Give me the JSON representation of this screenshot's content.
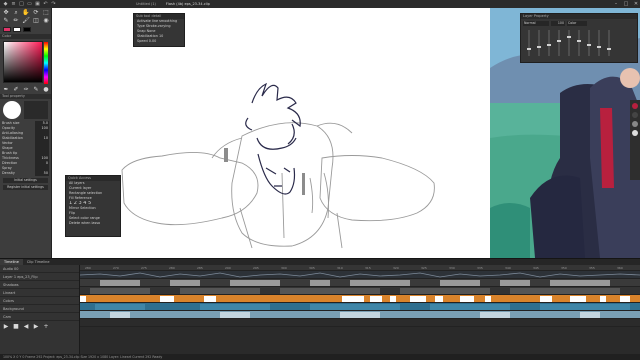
{
  "window": {
    "tabs": [
      "Untitled (1)",
      "Flash (4b) eps_23-34.clip"
    ],
    "controls": [
      "minimize",
      "maximize",
      "close"
    ]
  },
  "tool_property": {
    "title": "Tool property",
    "rows": [
      {
        "label": "Brush size",
        "value": "5.0"
      },
      {
        "label": "Opacity",
        "value": "100"
      },
      {
        "label": "Anti-aliasing",
        "value": ""
      },
      {
        "label": "Stabilization",
        "value": "10"
      },
      {
        "label": "Vector",
        "value": ""
      },
      {
        "label": "Shape",
        "value": ""
      },
      {
        "label": "Brush tip",
        "value": ""
      },
      {
        "label": "Thickness",
        "value": "100"
      },
      {
        "label": "Direction",
        "value": "0"
      },
      {
        "label": "Spray",
        "value": ""
      },
      {
        "label": "Density",
        "value": "50"
      }
    ],
    "buttons": [
      "Initial settings",
      "Register initial settings"
    ]
  },
  "color_wheel": {
    "current": "#e0356a",
    "secondary": "#ffffff"
  },
  "floating_top": {
    "title": "Sub tool detail",
    "rows": [
      "Activate line smoothing",
      "Type  Stroke-varying",
      "Snap  None",
      "Stabilization  10",
      "Speed  0.00"
    ]
  },
  "floating_quick": {
    "title": "Quick Access",
    "rows": [
      "All layers",
      "Current layer",
      "Rectangle selection",
      "Fill Reference",
      "1  2  3  4  5",
      "Mirror Selection",
      "Flip",
      "Select color range",
      "Delete when lasso"
    ]
  },
  "right_panel": {
    "title": "Layer Property",
    "rows": [
      "Normal",
      "100",
      "Color"
    ]
  },
  "timeline": {
    "tabs": [
      "Timeline",
      "Clip Timeline"
    ],
    "tracks": [
      "Audio 00",
      "Layer 1 eps_23_Flip",
      "Shadows",
      "Lineart",
      "Colors",
      "Background",
      "Cam"
    ],
    "ruler": [
      "280",
      "270",
      "275",
      "280",
      "285",
      "290",
      "295",
      "300",
      "305",
      "310",
      "315",
      "320",
      "325",
      "330",
      "335",
      "340",
      "345",
      "350",
      "355",
      "360"
    ]
  },
  "status": {
    "text": "100%   X 0 Y 0   Frame 292   Project: eps_23-34.clip   Size 1920 x 1080   Layer: Lineart   Current 292   Ready"
  }
}
